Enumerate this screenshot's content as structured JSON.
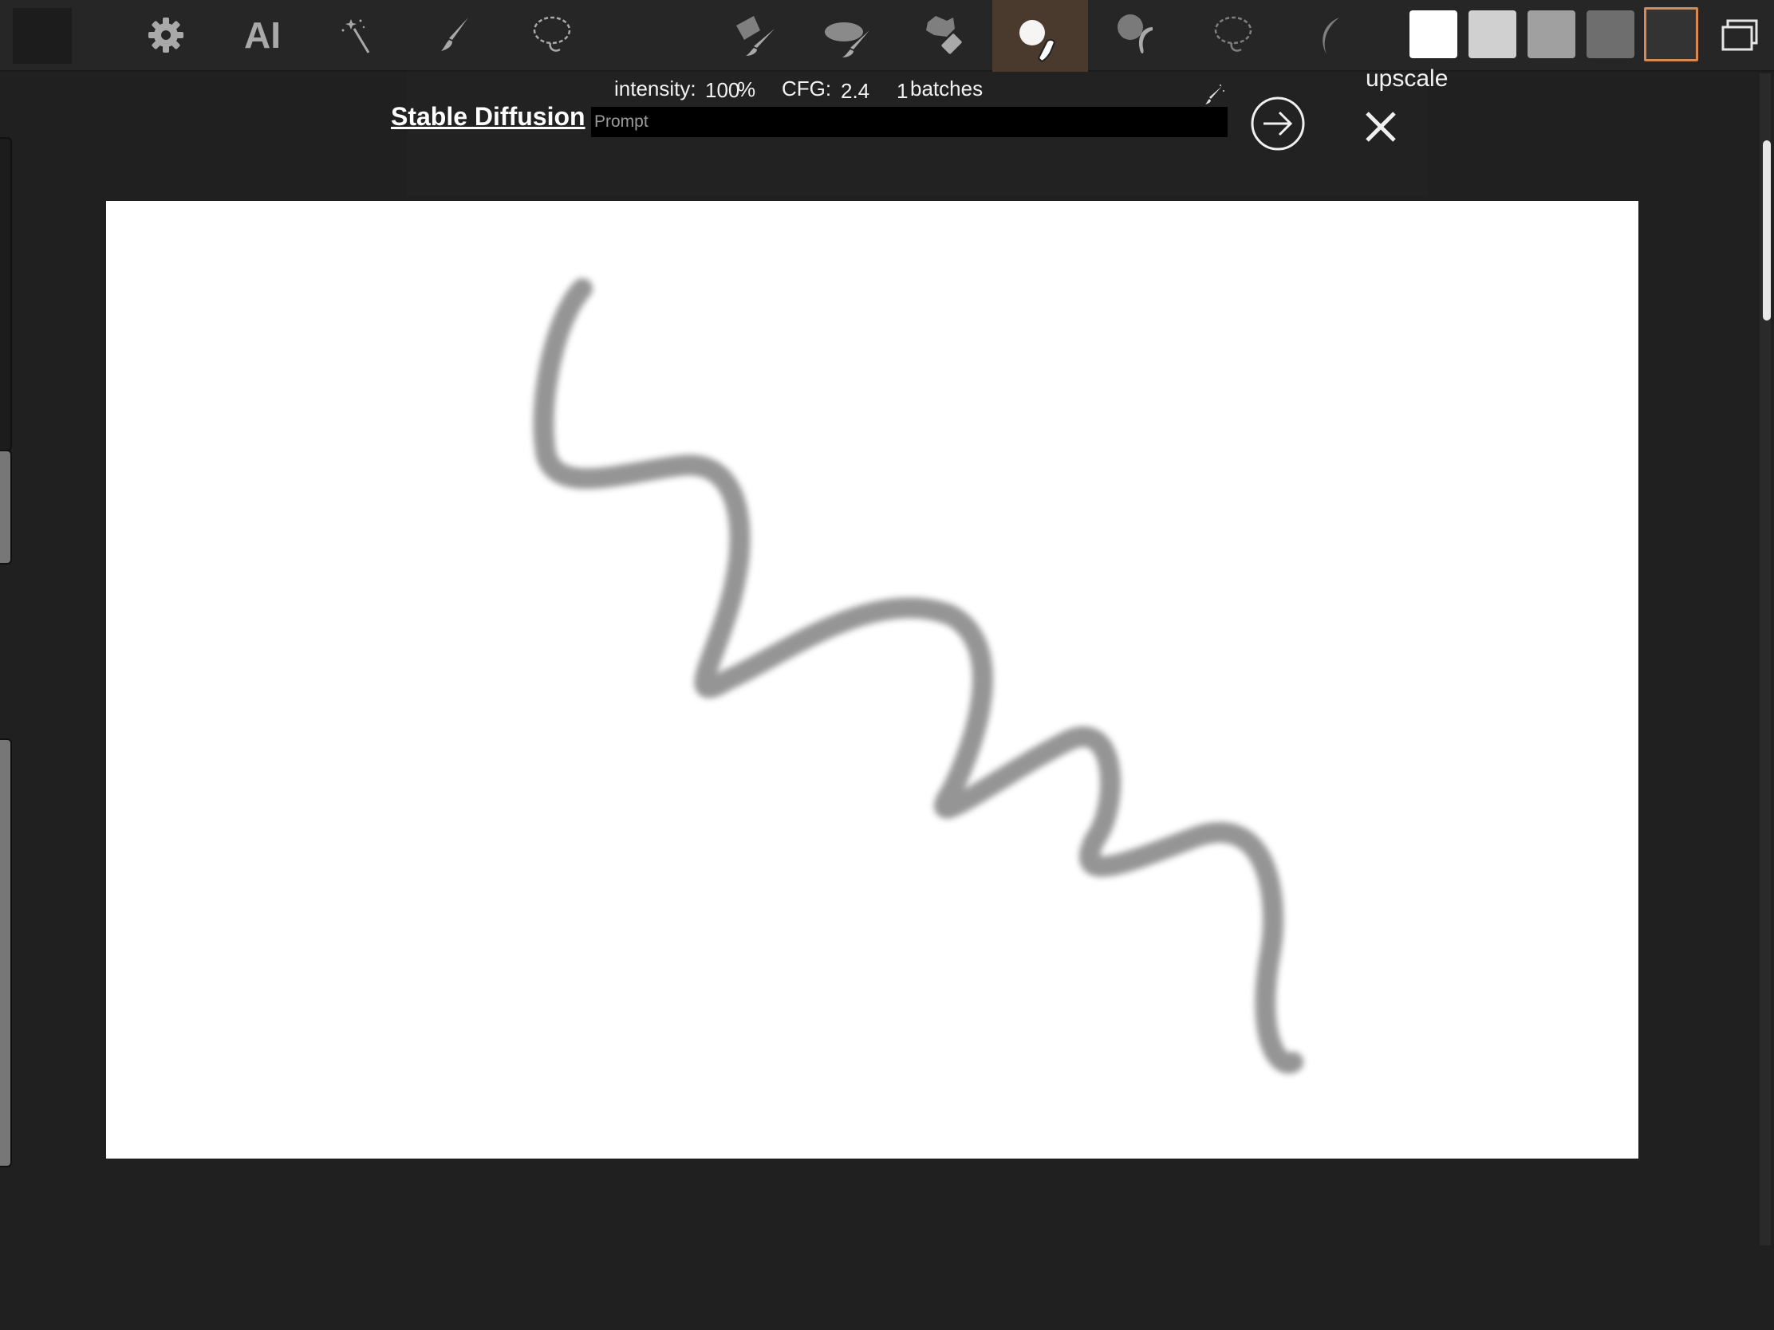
{
  "toolbar": {
    "tools": [
      {
        "name": "settings",
        "icon": "gear-icon"
      },
      {
        "name": "ai",
        "label": "AI"
      },
      {
        "name": "magic-wand",
        "icon": "magic-wand-icon"
      },
      {
        "name": "brush",
        "icon": "brush-icon"
      },
      {
        "name": "lasso",
        "icon": "lasso-icon"
      },
      {
        "name": "smudge-brush",
        "icon": "smudge-brush-icon"
      },
      {
        "name": "oval-brush",
        "icon": "oval-brush-icon"
      },
      {
        "name": "eraser",
        "icon": "eraser-icon"
      },
      {
        "name": "blur-finger",
        "icon": "blur-finger-icon",
        "active": true
      },
      {
        "name": "liquify",
        "icon": "liquify-icon"
      },
      {
        "name": "lasso-2",
        "icon": "lasso-icon"
      },
      {
        "name": "curve",
        "icon": "curve-icon"
      }
    ],
    "swatches": [
      "#ffffff",
      "#d0d0d0",
      "#a0a0a0",
      "#6e6e6e",
      "#333333"
    ],
    "active_accent": "#d98a4e"
  },
  "sd": {
    "title": "Stable Diffusion",
    "intensity_label": "intensity:",
    "intensity_value": "100",
    "intensity_unit": "%",
    "cfg_label": "CFG:",
    "cfg_value": "2.4",
    "batches_value": "1",
    "batches_label": "batches",
    "prompt_placeholder": "Prompt",
    "upscale_label": "upscale"
  }
}
